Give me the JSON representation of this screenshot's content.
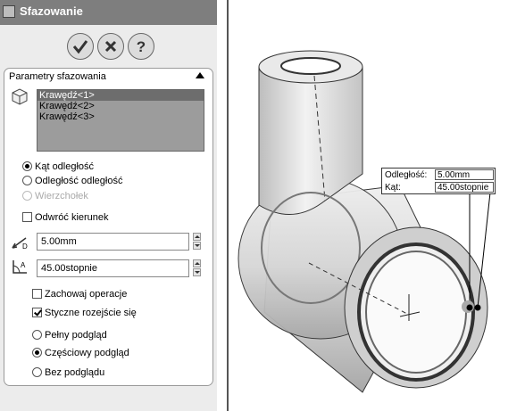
{
  "window": {
    "title": "Sfazowanie"
  },
  "actions": {
    "ok": "ok",
    "cancel": "cancel",
    "help": "?"
  },
  "params": {
    "title": "Parametry sfazowania",
    "edges": [
      "Krawędź<1>",
      "Krawędź<2>",
      "Krawędź<3>"
    ],
    "selected_edge": 0
  },
  "mode": {
    "options": [
      "Kąt odległość",
      "Odległość odległość",
      "Wierzchołek"
    ],
    "selected": 0,
    "disabled_index": 2
  },
  "reverse": {
    "label": "Odwróć kierunek",
    "checked": false
  },
  "distance": {
    "value": "5.00mm",
    "icon": "distance-icon"
  },
  "angle": {
    "value": "45.00stopnie",
    "icon": "angle-icon"
  },
  "keep_features": {
    "label": "Zachowaj operacje",
    "checked": false
  },
  "tangent": {
    "label": "Styczne rozejście się",
    "checked": true
  },
  "preview": {
    "options": [
      "Pełny podgląd",
      "Częściowy podgląd",
      "Bez podglądu"
    ],
    "selected": 1
  },
  "callout": {
    "distance_label": "Odległość:",
    "distance_value": "5.00mm",
    "angle_label": "Kąt:",
    "angle_value": "45.00stopnie"
  },
  "colors": {
    "title_bar": "#7e7e7e",
    "panel": "#ececec",
    "list_bg": "#9c9c9c",
    "selected_item": "#6d6d6d",
    "model_gray": "#d8d8d8"
  }
}
